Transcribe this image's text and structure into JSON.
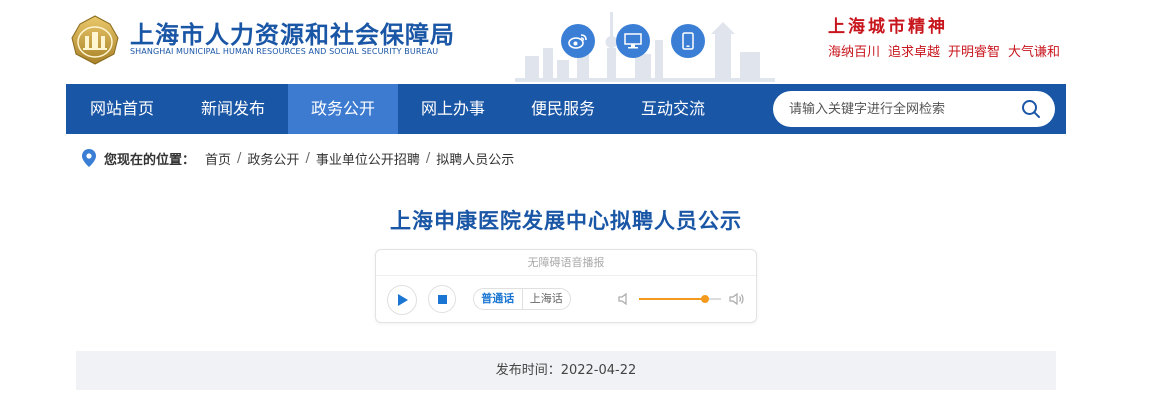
{
  "header": {
    "title_cn": "上海市人力资源和社会保障局",
    "title_en": "SHANGHAI MUNICIPAL HUMAN RESOURCES AND SOCIAL SECURITY BUREAU",
    "logo_icon": "bureau-emblem-icon",
    "icons": [
      "weibo-icon",
      "desktop-icon",
      "mobile-icon"
    ],
    "spirit_title": "上海城市精神",
    "spirit_words": [
      "海纳百川",
      "追求卓越",
      "开明睿智",
      "大气谦和"
    ]
  },
  "nav": {
    "items": [
      {
        "label": "网站首页",
        "active": false
      },
      {
        "label": "新闻发布",
        "active": false
      },
      {
        "label": "政务公开",
        "active": true
      },
      {
        "label": "网上办事",
        "active": false
      },
      {
        "label": "便民服务",
        "active": false
      },
      {
        "label": "互动交流",
        "active": false
      }
    ],
    "search": {
      "placeholder": "请输入关键字进行全网检索",
      "value": ""
    }
  },
  "breadcrumb": {
    "label": "您现在的位置：",
    "items": [
      "首页",
      "政务公开",
      "事业单位公开招聘",
      "拟聘人员公示"
    ]
  },
  "article": {
    "title": "上海申康医院发展中心拟聘人员公示",
    "publish_label": "发布时间：",
    "publish_date": "2022-04-22"
  },
  "player": {
    "label": "无障碍语音播报",
    "lang_options": [
      "普通话",
      "上海话"
    ],
    "active_lang": "普通话",
    "volume": 0.8
  },
  "colors": {
    "brand": "#1a56a6",
    "nav_active": "#3d7bd1",
    "spirit_red": "#c8161d",
    "volume_accent": "#f39a1e",
    "icon_button": "#3a7fd5"
  }
}
